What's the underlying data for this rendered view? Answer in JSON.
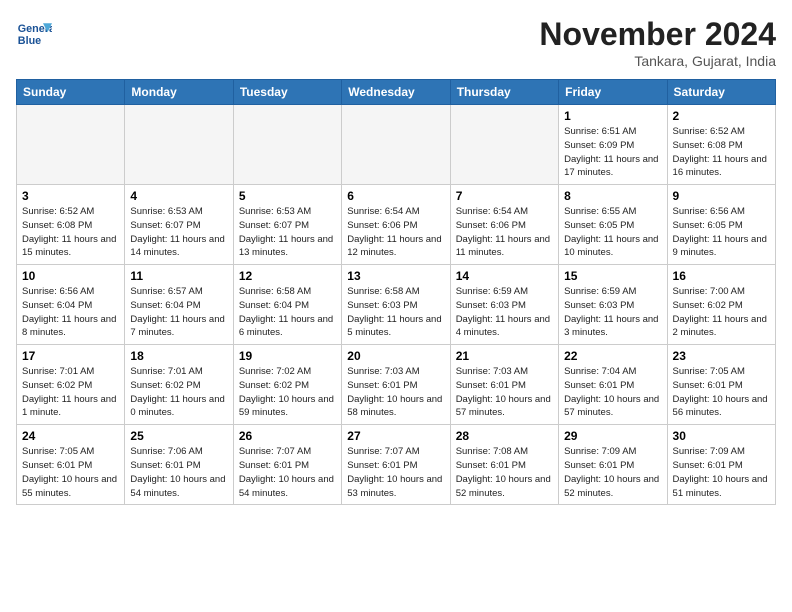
{
  "header": {
    "logo_line1": "General",
    "logo_line2": "Blue",
    "title": "November 2024",
    "subtitle": "Tankara, Gujarat, India"
  },
  "weekdays": [
    "Sunday",
    "Monday",
    "Tuesday",
    "Wednesday",
    "Thursday",
    "Friday",
    "Saturday"
  ],
  "weeks": [
    [
      {
        "day": "",
        "info": ""
      },
      {
        "day": "",
        "info": ""
      },
      {
        "day": "",
        "info": ""
      },
      {
        "day": "",
        "info": ""
      },
      {
        "day": "",
        "info": ""
      },
      {
        "day": "1",
        "info": "Sunrise: 6:51 AM\nSunset: 6:09 PM\nDaylight: 11 hours\nand 17 minutes."
      },
      {
        "day": "2",
        "info": "Sunrise: 6:52 AM\nSunset: 6:08 PM\nDaylight: 11 hours\nand 16 minutes."
      }
    ],
    [
      {
        "day": "3",
        "info": "Sunrise: 6:52 AM\nSunset: 6:08 PM\nDaylight: 11 hours\nand 15 minutes."
      },
      {
        "day": "4",
        "info": "Sunrise: 6:53 AM\nSunset: 6:07 PM\nDaylight: 11 hours\nand 14 minutes."
      },
      {
        "day": "5",
        "info": "Sunrise: 6:53 AM\nSunset: 6:07 PM\nDaylight: 11 hours\nand 13 minutes."
      },
      {
        "day": "6",
        "info": "Sunrise: 6:54 AM\nSunset: 6:06 PM\nDaylight: 11 hours\nand 12 minutes."
      },
      {
        "day": "7",
        "info": "Sunrise: 6:54 AM\nSunset: 6:06 PM\nDaylight: 11 hours\nand 11 minutes."
      },
      {
        "day": "8",
        "info": "Sunrise: 6:55 AM\nSunset: 6:05 PM\nDaylight: 11 hours\nand 10 minutes."
      },
      {
        "day": "9",
        "info": "Sunrise: 6:56 AM\nSunset: 6:05 PM\nDaylight: 11 hours\nand 9 minutes."
      }
    ],
    [
      {
        "day": "10",
        "info": "Sunrise: 6:56 AM\nSunset: 6:04 PM\nDaylight: 11 hours\nand 8 minutes."
      },
      {
        "day": "11",
        "info": "Sunrise: 6:57 AM\nSunset: 6:04 PM\nDaylight: 11 hours\nand 7 minutes."
      },
      {
        "day": "12",
        "info": "Sunrise: 6:58 AM\nSunset: 6:04 PM\nDaylight: 11 hours\nand 6 minutes."
      },
      {
        "day": "13",
        "info": "Sunrise: 6:58 AM\nSunset: 6:03 PM\nDaylight: 11 hours\nand 5 minutes."
      },
      {
        "day": "14",
        "info": "Sunrise: 6:59 AM\nSunset: 6:03 PM\nDaylight: 11 hours\nand 4 minutes."
      },
      {
        "day": "15",
        "info": "Sunrise: 6:59 AM\nSunset: 6:03 PM\nDaylight: 11 hours\nand 3 minutes."
      },
      {
        "day": "16",
        "info": "Sunrise: 7:00 AM\nSunset: 6:02 PM\nDaylight: 11 hours\nand 2 minutes."
      }
    ],
    [
      {
        "day": "17",
        "info": "Sunrise: 7:01 AM\nSunset: 6:02 PM\nDaylight: 11 hours\nand 1 minute."
      },
      {
        "day": "18",
        "info": "Sunrise: 7:01 AM\nSunset: 6:02 PM\nDaylight: 11 hours\nand 0 minutes."
      },
      {
        "day": "19",
        "info": "Sunrise: 7:02 AM\nSunset: 6:02 PM\nDaylight: 10 hours\nand 59 minutes."
      },
      {
        "day": "20",
        "info": "Sunrise: 7:03 AM\nSunset: 6:01 PM\nDaylight: 10 hours\nand 58 minutes."
      },
      {
        "day": "21",
        "info": "Sunrise: 7:03 AM\nSunset: 6:01 PM\nDaylight: 10 hours\nand 57 minutes."
      },
      {
        "day": "22",
        "info": "Sunrise: 7:04 AM\nSunset: 6:01 PM\nDaylight: 10 hours\nand 57 minutes."
      },
      {
        "day": "23",
        "info": "Sunrise: 7:05 AM\nSunset: 6:01 PM\nDaylight: 10 hours\nand 56 minutes."
      }
    ],
    [
      {
        "day": "24",
        "info": "Sunrise: 7:05 AM\nSunset: 6:01 PM\nDaylight: 10 hours\nand 55 minutes."
      },
      {
        "day": "25",
        "info": "Sunrise: 7:06 AM\nSunset: 6:01 PM\nDaylight: 10 hours\nand 54 minutes."
      },
      {
        "day": "26",
        "info": "Sunrise: 7:07 AM\nSunset: 6:01 PM\nDaylight: 10 hours\nand 54 minutes."
      },
      {
        "day": "27",
        "info": "Sunrise: 7:07 AM\nSunset: 6:01 PM\nDaylight: 10 hours\nand 53 minutes."
      },
      {
        "day": "28",
        "info": "Sunrise: 7:08 AM\nSunset: 6:01 PM\nDaylight: 10 hours\nand 52 minutes."
      },
      {
        "day": "29",
        "info": "Sunrise: 7:09 AM\nSunset: 6:01 PM\nDaylight: 10 hours\nand 52 minutes."
      },
      {
        "day": "30",
        "info": "Sunrise: 7:09 AM\nSunset: 6:01 PM\nDaylight: 10 hours\nand 51 minutes."
      }
    ]
  ]
}
